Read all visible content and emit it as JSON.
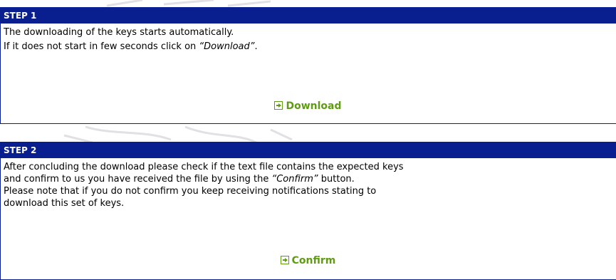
{
  "step1": {
    "header": "STEP 1",
    "lines": [
      "The downloading of the keys starts automatically."
    ],
    "line2_prefix": "If it does not start in few seconds click on ",
    "line2_emph": "“Download”",
    "line2_suffix": ".",
    "action_label": "Download"
  },
  "step2": {
    "header": "STEP 2",
    "line1": "After concluding the download please check if the text file contains the expected keys",
    "line2_prefix": "and confirm to us you have received the file by using the ",
    "line2_emph": "“Confirm”",
    "line2_suffix": " button.",
    "line3": "Please note that if you do not confirm you keep receiving notifications stating to",
    "line4": "download this set of keys.",
    "action_label": "Confirm"
  },
  "colors": {
    "header_bg": "#0a1f8f",
    "action_green": "#5f9c14"
  }
}
